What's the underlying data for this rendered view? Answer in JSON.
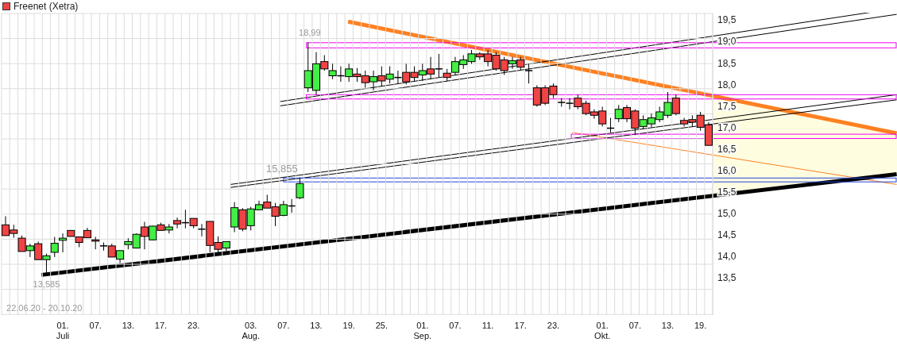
{
  "chart_data": {
    "type": "candlestick",
    "categories": [
      null,
      null,
      null,
      null,
      null,
      null,
      null,
      "01.\nJuli",
      null,
      null,
      null,
      "07.",
      null,
      null,
      null,
      "13.",
      null,
      null,
      null,
      "17.",
      null,
      null,
      null,
      "23.",
      null,
      null,
      null,
      null,
      null,
      null,
      "03.\nAug.",
      null,
      null,
      null,
      "07.",
      null,
      null,
      null,
      "13.",
      null,
      null,
      null,
      "19.",
      null,
      null,
      null,
      "25.",
      null,
      null,
      null,
      null,
      "01.\nSep.",
      null,
      null,
      null,
      "07.",
      null,
      null,
      null,
      "11.",
      null,
      null,
      null,
      "17.",
      null,
      null,
      null,
      "23.",
      null,
      null,
      null,
      null,
      null,
      "01.\nOkt.",
      null,
      null,
      null,
      "07.",
      null,
      null,
      null,
      "13.",
      null,
      null,
      null,
      "19.",
      null
    ],
    "series": [
      {
        "name": "Freenet (Xetra)",
        "ohlc": [
          [
            14.75,
            14.95,
            14.5,
            14.5
          ],
          [
            14.63,
            14.75,
            14.45,
            14.55
          ],
          [
            14.44,
            14.5,
            14.13,
            14.13
          ],
          [
            14.15,
            14.31,
            14.0,
            14.26
          ],
          [
            14.31,
            14.36,
            13.94,
            13.94
          ],
          [
            13.94,
            14.08,
            13.585,
            14.03
          ],
          [
            14.11,
            14.47,
            14.0,
            14.32
          ],
          [
            14.39,
            14.55,
            14.11,
            14.44
          ],
          [
            14.62,
            14.62,
            14.48,
            14.48
          ],
          [
            14.47,
            14.47,
            14.23,
            14.34
          ],
          [
            14.62,
            14.68,
            14.45,
            14.45
          ],
          [
            14.4,
            14.47,
            14.18,
            14.37
          ],
          [
            14.26,
            14.34,
            14.15,
            14.26
          ],
          [
            14.26,
            14.31,
            14.0,
            14.0
          ],
          [
            13.95,
            14.15,
            13.86,
            14.15
          ],
          [
            14.29,
            14.44,
            14.18,
            14.36
          ],
          [
            14.21,
            14.55,
            14.2,
            14.53
          ],
          [
            14.7,
            14.82,
            14.18,
            14.48
          ],
          [
            14.4,
            14.73,
            14.39,
            14.72
          ],
          [
            14.75,
            14.8,
            14.62,
            14.62
          ],
          [
            14.63,
            14.77,
            14.55,
            14.7
          ],
          [
            14.85,
            14.92,
            14.67,
            14.77
          ],
          [
            14.8,
            15.1,
            14.67,
            14.8
          ],
          [
            14.9,
            14.9,
            14.67,
            14.73
          ],
          [
            14.65,
            14.77,
            14.48,
            14.65
          ],
          [
            14.83,
            14.83,
            14.11,
            14.27
          ],
          [
            14.34,
            14.48,
            14.05,
            14.18
          ],
          [
            14.21,
            14.36,
            14.14,
            14.36
          ],
          [
            14.7,
            15.28,
            14.58,
            15.15
          ],
          [
            15.1,
            15.14,
            14.6,
            14.65
          ],
          [
            14.73,
            15.17,
            14.62,
            15.12
          ],
          [
            15.1,
            15.31,
            15.09,
            15.22
          ],
          [
            15.28,
            15.45,
            15.14,
            15.14
          ],
          [
            15.17,
            15.26,
            14.72,
            14.95
          ],
          [
            14.97,
            15.31,
            14.95,
            15.22
          ],
          [
            15.19,
            15.35,
            15.03,
            15.19
          ],
          [
            15.38,
            15.855,
            15.35,
            15.71
          ],
          [
            17.94,
            18.99,
            17.84,
            18.34
          ],
          [
            17.88,
            18.77,
            17.78,
            18.5
          ],
          [
            18.55,
            18.7,
            18.34,
            18.38
          ],
          [
            18.22,
            18.5,
            18.14,
            18.34
          ],
          [
            18.22,
            18.44,
            18.08,
            18.22
          ],
          [
            18.2,
            18.5,
            18.08,
            18.38
          ],
          [
            18.26,
            18.4,
            18.08,
            18.2
          ],
          [
            18.22,
            18.34,
            17.94,
            18.06
          ],
          [
            18.08,
            18.34,
            17.88,
            18.2
          ],
          [
            18.22,
            18.44,
            17.98,
            18.1
          ],
          [
            18.14,
            18.44,
            18.04,
            18.26
          ],
          [
            18.18,
            18.34,
            18.04,
            18.18
          ],
          [
            18.3,
            18.5,
            18.02,
            18.08
          ],
          [
            18.3,
            18.44,
            18.1,
            18.18
          ],
          [
            18.24,
            18.5,
            18.1,
            18.34
          ],
          [
            18.38,
            18.66,
            18.14,
            18.26
          ],
          [
            18.38,
            18.73,
            18.18,
            18.38
          ],
          [
            18.28,
            18.38,
            18.1,
            18.18
          ],
          [
            18.3,
            18.66,
            18.24,
            18.55
          ],
          [
            18.48,
            18.7,
            18.38,
            18.59
          ],
          [
            18.55,
            18.82,
            18.5,
            18.73
          ],
          [
            18.73,
            18.77,
            18.59,
            18.66
          ],
          [
            18.73,
            18.82,
            18.44,
            18.55
          ],
          [
            18.7,
            18.77,
            18.34,
            18.38
          ],
          [
            18.59,
            18.66,
            18.24,
            18.34
          ],
          [
            18.5,
            18.66,
            18.38,
            18.57
          ],
          [
            18.59,
            18.66,
            18.34,
            18.42
          ],
          [
            18.34,
            18.5,
            18.04,
            18.34
          ],
          [
            17.94,
            18.0,
            17.5,
            17.54
          ],
          [
            17.94,
            18.0,
            17.54,
            17.58
          ],
          [
            17.98,
            18.04,
            17.7,
            17.78
          ],
          [
            17.6,
            17.7,
            17.5,
            17.6
          ],
          [
            17.58,
            17.7,
            17.44,
            17.58
          ],
          [
            17.7,
            17.78,
            17.44,
            17.5
          ],
          [
            17.58,
            17.64,
            17.3,
            17.34
          ],
          [
            17.38,
            17.44,
            17.22,
            17.3
          ],
          [
            17.4,
            17.5,
            17.04,
            17.1
          ],
          [
            17.0,
            17.24,
            16.9,
            17.0
          ],
          [
            17.22,
            17.54,
            17.14,
            17.44
          ],
          [
            17.48,
            17.54,
            17.14,
            17.22
          ],
          [
            17.4,
            17.44,
            16.84,
            17.0
          ],
          [
            17.04,
            17.3,
            16.98,
            17.2
          ],
          [
            17.1,
            17.34,
            17.02,
            17.24
          ],
          [
            17.2,
            17.5,
            17.14,
            17.38
          ],
          [
            17.3,
            17.84,
            17.24,
            17.6
          ],
          [
            17.7,
            17.78,
            17.3,
            17.34
          ],
          [
            17.18,
            17.24,
            17.04,
            17.1
          ],
          [
            17.2,
            17.3,
            17.04,
            17.14
          ],
          [
            17.3,
            17.38,
            16.94,
            17.02
          ],
          [
            17.08,
            17.14,
            16.6,
            16.6
          ]
        ]
      }
    ],
    "ylim": [
      12.65,
      19.67
    ],
    "yticks": [
      {
        "value": 19.5,
        "label": "19,5"
      },
      {
        "value": 19.0,
        "label": "19,0"
      },
      {
        "value": 18.5,
        "label": "18,5"
      },
      {
        "value": 18.0,
        "label": "18,0"
      },
      {
        "value": 17.5,
        "label": "17,5"
      },
      {
        "value": 17.0,
        "label": "17,0"
      },
      {
        "value": 16.5,
        "label": "16,5"
      },
      {
        "value": 16.0,
        "label": "16,0"
      },
      {
        "value": 15.5,
        "label": "15,5"
      },
      {
        "value": 15.0,
        "label": "15,0"
      },
      {
        "value": 14.5,
        "label": "14,5"
      },
      {
        "value": 14.0,
        "label": "14,0"
      },
      {
        "value": 13.5,
        "label": "13,5"
      }
    ],
    "annotations": [
      "18,99",
      "15,855",
      "13,585",
      "22.06.20 - 20.10.20"
    ]
  }
}
